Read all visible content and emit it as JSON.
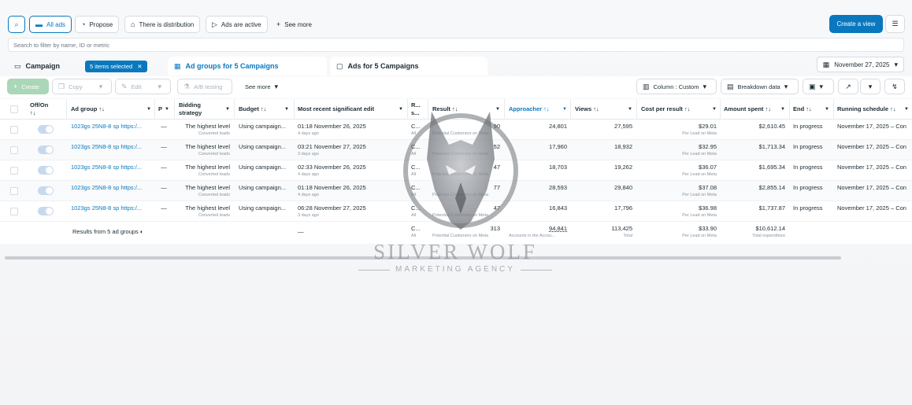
{
  "toolbar": {
    "all_ads": "All ads",
    "propose": "Propose",
    "distribution": "There is distribution",
    "active": "Ads are active",
    "see_more": "See more",
    "create_view": "Create a view"
  },
  "search": {
    "placeholder": "Search to filter by name, ID or metric"
  },
  "tabs": {
    "campaign": "Campaign",
    "selected": "5 items selected",
    "ad_groups": "Ad groups for 5 Campaigns",
    "ads": "Ads for 5 Campaigns",
    "date": "November 27, 2025"
  },
  "actions": {
    "create": "Create",
    "copy": "Copy",
    "edit": "Edit",
    "ab_testing": "A/B testing",
    "see_more": "See more",
    "columns": "Column : Custom",
    "breakdown": "Breakdown data"
  },
  "table": {
    "headers": {
      "offon": "Off/On",
      "offon_sort": "↑↓",
      "adgroup": "Ad group ↑↓",
      "p": "P",
      "bidding": "Bidding strategy",
      "budget": "Budget ↑↓",
      "edit": "Most recent significant edit",
      "rs": "R... s...",
      "result": "Result ↑↓",
      "approacher": "Approacher ↑↓",
      "views": "Views ↑↓",
      "cpr": "Cost per result ↑↓",
      "spent": "Amount spent ↑↓",
      "end": "End ↑↓",
      "schedule": "Running schedule ↑↓"
    },
    "rows": [
      {
        "name": "1023gs 25N8-8 sp https:/...",
        "p": "—",
        "bid": "The highest level",
        "bid_sub": "Converted leads",
        "budget": "Using campaign...",
        "edit": "01:18 November 26, 2025",
        "edit_sub": "4 days ago",
        "rs": "C...",
        "rs_sub": "All",
        "result": "90",
        "result_sub": "Potential Customers on Meta",
        "approacher": "24,801",
        "views": "27,595",
        "cpr": "$29.01",
        "cpr_sub": "Per Lead on Meta",
        "spent": "$2,610.45",
        "end": "In progress",
        "schedule": "November 17, 2025 – Con"
      },
      {
        "name": "1023gs 25N8-8 sp https:/...",
        "p": "—",
        "bid": "The highest level",
        "bid_sub": "Converted leads",
        "budget": "Using campaign...",
        "edit": "03:21 November 27, 2025",
        "edit_sub": "3 days ago",
        "rs": "C...",
        "rs_sub": "All",
        "result": "52",
        "result_sub": "Potential Customers on Meta",
        "approacher": "17,960",
        "views": "18,932",
        "cpr": "$32.95",
        "cpr_sub": "Per Lead on Meta",
        "spent": "$1,713.34",
        "end": "In progress",
        "schedule": "November 17, 2025 – Con"
      },
      {
        "name": "1023gs 25N8-8 sp https:/...",
        "p": "—",
        "bid": "The highest level",
        "bid_sub": "Converted leads",
        "budget": "Using campaign...",
        "edit": "02:33 November 26, 2025",
        "edit_sub": "4 days ago",
        "rs": "C...",
        "rs_sub": "All",
        "result": "47",
        "result_sub": "Potential Customers on Meta",
        "approacher": "18,703",
        "views": "19,262",
        "cpr": "$36.07",
        "cpr_sub": "Per Lead on Meta",
        "spent": "$1,695.34",
        "end": "In progress",
        "schedule": "November 17, 2025 – Con"
      },
      {
        "name": "1023gs 25N8-8 sp https:/...",
        "p": "—",
        "bid": "The highest level",
        "bid_sub": "Converted leads",
        "budget": "Using campaign...",
        "edit": "01:18 November 26, 2025",
        "edit_sub": "4 days ago",
        "rs": "C...",
        "rs_sub": "All",
        "result": "77",
        "result_sub": "Potential Customers on Meta",
        "approacher": "28,593",
        "views": "29,840",
        "cpr": "$37.08",
        "cpr_sub": "Per Lead on Meta",
        "spent": "$2,855.14",
        "end": "In progress",
        "schedule": "November 17, 2025 – Con"
      },
      {
        "name": "1023gs 25N8-8 sp https:/...",
        "p": "—",
        "bid": "The highest level",
        "bid_sub": "Converted leads",
        "budget": "Using campaign...",
        "edit": "06:28 November 27, 2025",
        "edit_sub": "3 days ago",
        "rs": "C...",
        "rs_sub": "All",
        "result": "47",
        "result_sub": "Potential Customers on Meta",
        "approacher": "16,843",
        "views": "17,796",
        "cpr": "$36.98",
        "cpr_sub": "Per Lead on Meta",
        "spent": "$1,737.87",
        "end": "In progress",
        "schedule": "November 17, 2025 – Con"
      }
    ],
    "totals": {
      "label": "Results from 5 ad groups",
      "edit": "—",
      "rs": "C...",
      "rs_sub": "All",
      "result": "313",
      "result_sub": "Potential Customers on Meta",
      "approacher": "94,841",
      "approacher_sub": "Accounts in the Accou...",
      "views": "113,425",
      "views_sub": "Total",
      "cpr": "$33.90",
      "cpr_sub": "Per Lead on Meta",
      "spent": "$10,612.14",
      "spent_sub": "Total expenditure"
    }
  },
  "watermark": {
    "title": "SILVER WOLF",
    "subtitle": "MARKETING AGENCY"
  },
  "colors": {
    "accent": "#0a78be",
    "toggle_on": "#c8d9ee"
  }
}
